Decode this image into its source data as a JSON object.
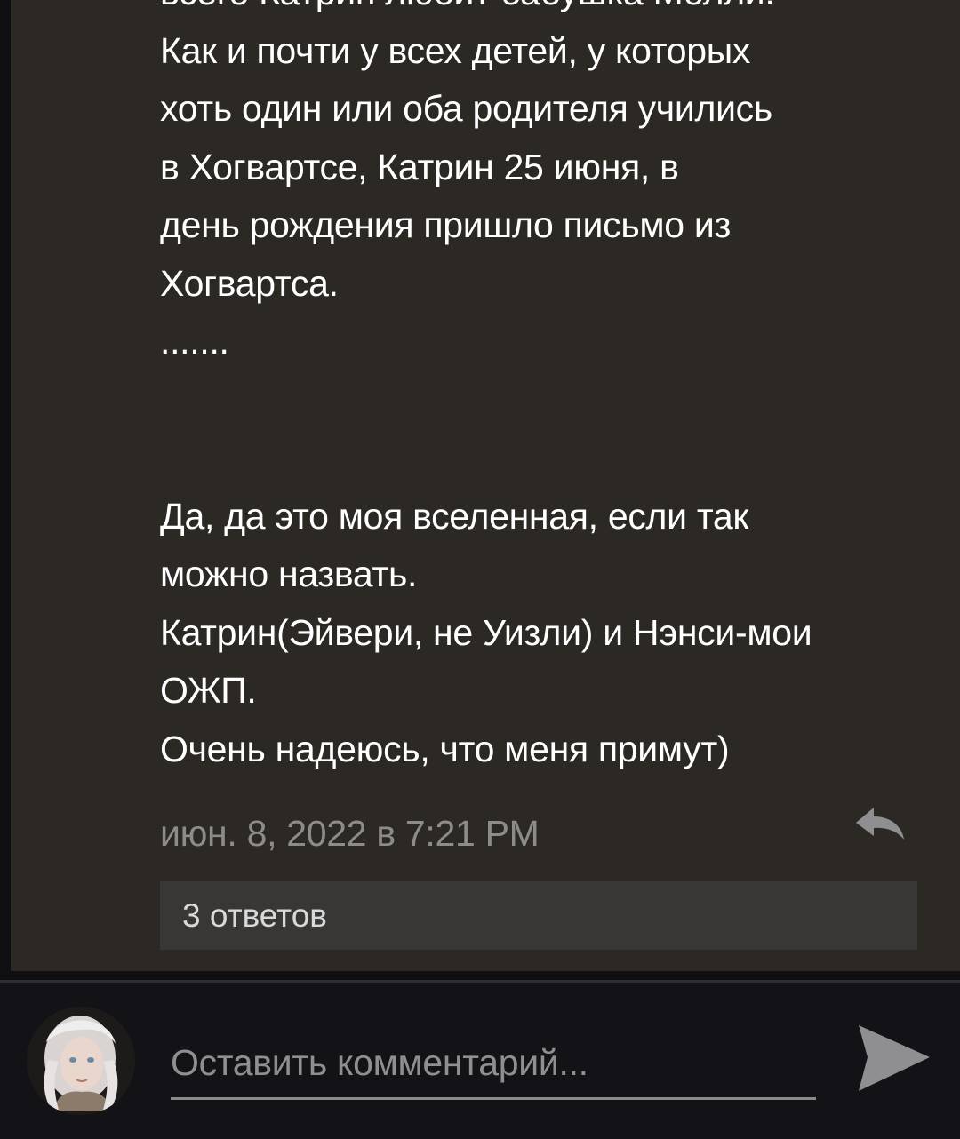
{
  "comment": {
    "lines": [
      "всего Катрин любит бабушка Молли.",
      "Как и почти у всех детей, у которых",
      "хоть один или оба родителя учились",
      "в Хогвартсе, Катрин 25 июня, в",
      "день рождения пришло письмо из",
      "Хогвартса.",
      ".......",
      "Да, да это моя вселенная, если так",
      "можно назвать.",
      "Катрин(Эйвери, не Уизли) и Нэнси-мои",
      "ОЖП.",
      "Очень надеюсь, что меня примут)"
    ],
    "timestamp": "июн. 8, 2022 в 7:21 PM",
    "reply_icon": "reply-arrow-icon",
    "replies_label": "3 ответов"
  },
  "composer": {
    "avatar": "user-avatar",
    "placeholder": "Оставить комментарий...",
    "value": "",
    "send_icon": "send-arrow-icon"
  },
  "colors": {
    "card_background": "#2c2824",
    "composer_background": "#131217",
    "text_primary": "#ffffff",
    "text_secondary": "#8e8c89",
    "replies_background": "#383735"
  }
}
